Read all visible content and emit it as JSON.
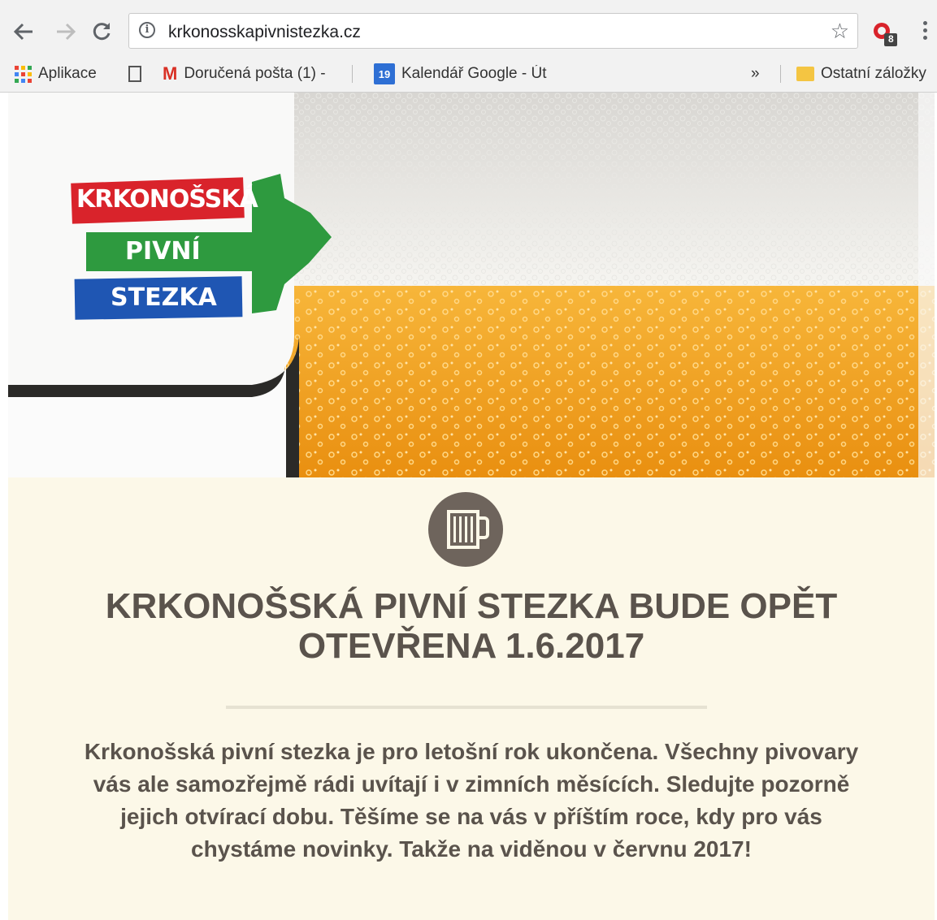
{
  "browser": {
    "url": "krkonosskapivnistezka.cz",
    "extension_badge": "8",
    "bookmarks": [
      {
        "label": "Aplikace"
      },
      {
        "label": ""
      },
      {
        "label": "Doručená pošta (1) -"
      },
      {
        "label": "Kalendář Google - Út",
        "icon_text": "19"
      },
      {
        "label": "Ostatní záložky"
      }
    ],
    "overflow_label": "»",
    "icons": [
      "back-arrow-icon",
      "forward-arrow-icon",
      "reload-icon",
      "info-icon",
      "star-icon",
      "apps-grid-icon",
      "page-icon",
      "gmail-icon",
      "calendar-icon",
      "folder-icon",
      "menu-icon"
    ]
  },
  "logo": {
    "line1": "KRKONOŠSKÁ",
    "line2": "PIVNÍ",
    "line3": "STEZKA",
    "colors": {
      "red": "#d9232b",
      "green": "#2e9a3f",
      "blue": "#1f56b3"
    }
  },
  "content": {
    "headline": "KRKONOŠSKÁ PIVNÍ STEZKA BUDE OPĚT OTEVŘENA 1.6.2017",
    "body": "Krkonošská pivní stezka je pro letošní rok ukončena. Všechny pivovary vás ale samozřejmě rádi uvítají i v zimních měsících. Sledujte  pozorně jejich otvírací dobu. Těšíme se na vás v příštím roce, kdy pro vás chystáme novinky. Takže na viděnou v červnu 2017!"
  },
  "colors": {
    "page_bg": "#fcf8e8",
    "text": "#5a534c",
    "badge": "#6e645c",
    "beer": "#f0a21c"
  }
}
